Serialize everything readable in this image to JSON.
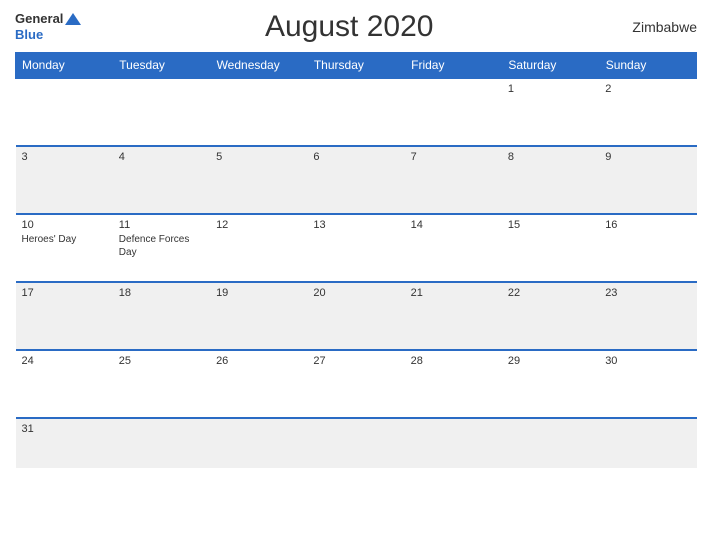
{
  "header": {
    "logo_general": "General",
    "logo_blue": "Blue",
    "title": "August 2020",
    "country": "Zimbabwe"
  },
  "weekdays": [
    "Monday",
    "Tuesday",
    "Wednesday",
    "Thursday",
    "Friday",
    "Saturday",
    "Sunday"
  ],
  "rows": [
    [
      {
        "date": "",
        "holiday": ""
      },
      {
        "date": "",
        "holiday": ""
      },
      {
        "date": "",
        "holiday": ""
      },
      {
        "date": "",
        "holiday": ""
      },
      {
        "date": "",
        "holiday": ""
      },
      {
        "date": "1",
        "holiday": ""
      },
      {
        "date": "2",
        "holiday": ""
      }
    ],
    [
      {
        "date": "3",
        "holiday": ""
      },
      {
        "date": "4",
        "holiday": ""
      },
      {
        "date": "5",
        "holiday": ""
      },
      {
        "date": "6",
        "holiday": ""
      },
      {
        "date": "7",
        "holiday": ""
      },
      {
        "date": "8",
        "holiday": ""
      },
      {
        "date": "9",
        "holiday": ""
      }
    ],
    [
      {
        "date": "10",
        "holiday": "Heroes' Day"
      },
      {
        "date": "11",
        "holiday": "Defence Forces Day"
      },
      {
        "date": "12",
        "holiday": ""
      },
      {
        "date": "13",
        "holiday": ""
      },
      {
        "date": "14",
        "holiday": ""
      },
      {
        "date": "15",
        "holiday": ""
      },
      {
        "date": "16",
        "holiday": ""
      }
    ],
    [
      {
        "date": "17",
        "holiday": ""
      },
      {
        "date": "18",
        "holiday": ""
      },
      {
        "date": "19",
        "holiday": ""
      },
      {
        "date": "20",
        "holiday": ""
      },
      {
        "date": "21",
        "holiday": ""
      },
      {
        "date": "22",
        "holiday": ""
      },
      {
        "date": "23",
        "holiday": ""
      }
    ],
    [
      {
        "date": "24",
        "holiday": ""
      },
      {
        "date": "25",
        "holiday": ""
      },
      {
        "date": "26",
        "holiday": ""
      },
      {
        "date": "27",
        "holiday": ""
      },
      {
        "date": "28",
        "holiday": ""
      },
      {
        "date": "29",
        "holiday": ""
      },
      {
        "date": "30",
        "holiday": ""
      }
    ],
    [
      {
        "date": "31",
        "holiday": ""
      },
      {
        "date": "",
        "holiday": ""
      },
      {
        "date": "",
        "holiday": ""
      },
      {
        "date": "",
        "holiday": ""
      },
      {
        "date": "",
        "holiday": ""
      },
      {
        "date": "",
        "holiday": ""
      },
      {
        "date": "",
        "holiday": ""
      }
    ]
  ]
}
